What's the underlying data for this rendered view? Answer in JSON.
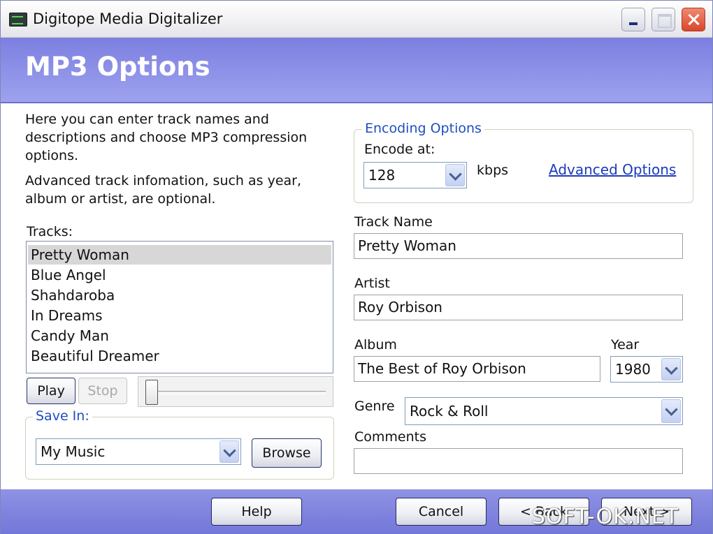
{
  "window": {
    "title": "Digitope Media Digitalizer"
  },
  "header": {
    "title": "MP3 Options"
  },
  "intro": {
    "line1": "Here you can enter track names and",
    "line2": "descriptions and choose MP3 compression",
    "line3": "options.",
    "line4": "Advanced track infomation, such as year,",
    "line5": "album or artist, are optional."
  },
  "tracks": {
    "label": "Tracks:",
    "items": [
      "Pretty Woman",
      "Blue Angel",
      "Shahdaroba",
      "In Dreams",
      "Candy Man",
      "Beautiful Dreamer"
    ],
    "selected_index": 0
  },
  "playback": {
    "play_label": "Play",
    "stop_label": "Stop",
    "position": 0
  },
  "save_in": {
    "legend": "Save In:",
    "value": "My Music",
    "browse_label": "Browse"
  },
  "encoding": {
    "legend": "Encoding Options",
    "encode_label": "Encode at:",
    "bitrate": "128",
    "unit": "kbps",
    "advanced_link": "Advanced Options"
  },
  "track_info": {
    "name_label": "Track Name",
    "name_value": "Pretty Woman",
    "artist_label": "Artist",
    "artist_value": "Roy Orbison",
    "album_label": "Album",
    "album_value": "The Best of Roy Orbison",
    "year_label": "Year",
    "year_value": "1980",
    "genre_label": "Genre",
    "genre_value": "Rock & Roll",
    "comments_label": "Comments",
    "comments_value": ""
  },
  "footer": {
    "help_label": "Help",
    "cancel_label": "Cancel",
    "back_label": "< Back",
    "next_label": "Next >"
  },
  "watermark": "SOFT-OK.NET",
  "colors": {
    "header": "#8487e3",
    "link": "#1a3bbd",
    "group_legend": "#1d4fbe"
  }
}
